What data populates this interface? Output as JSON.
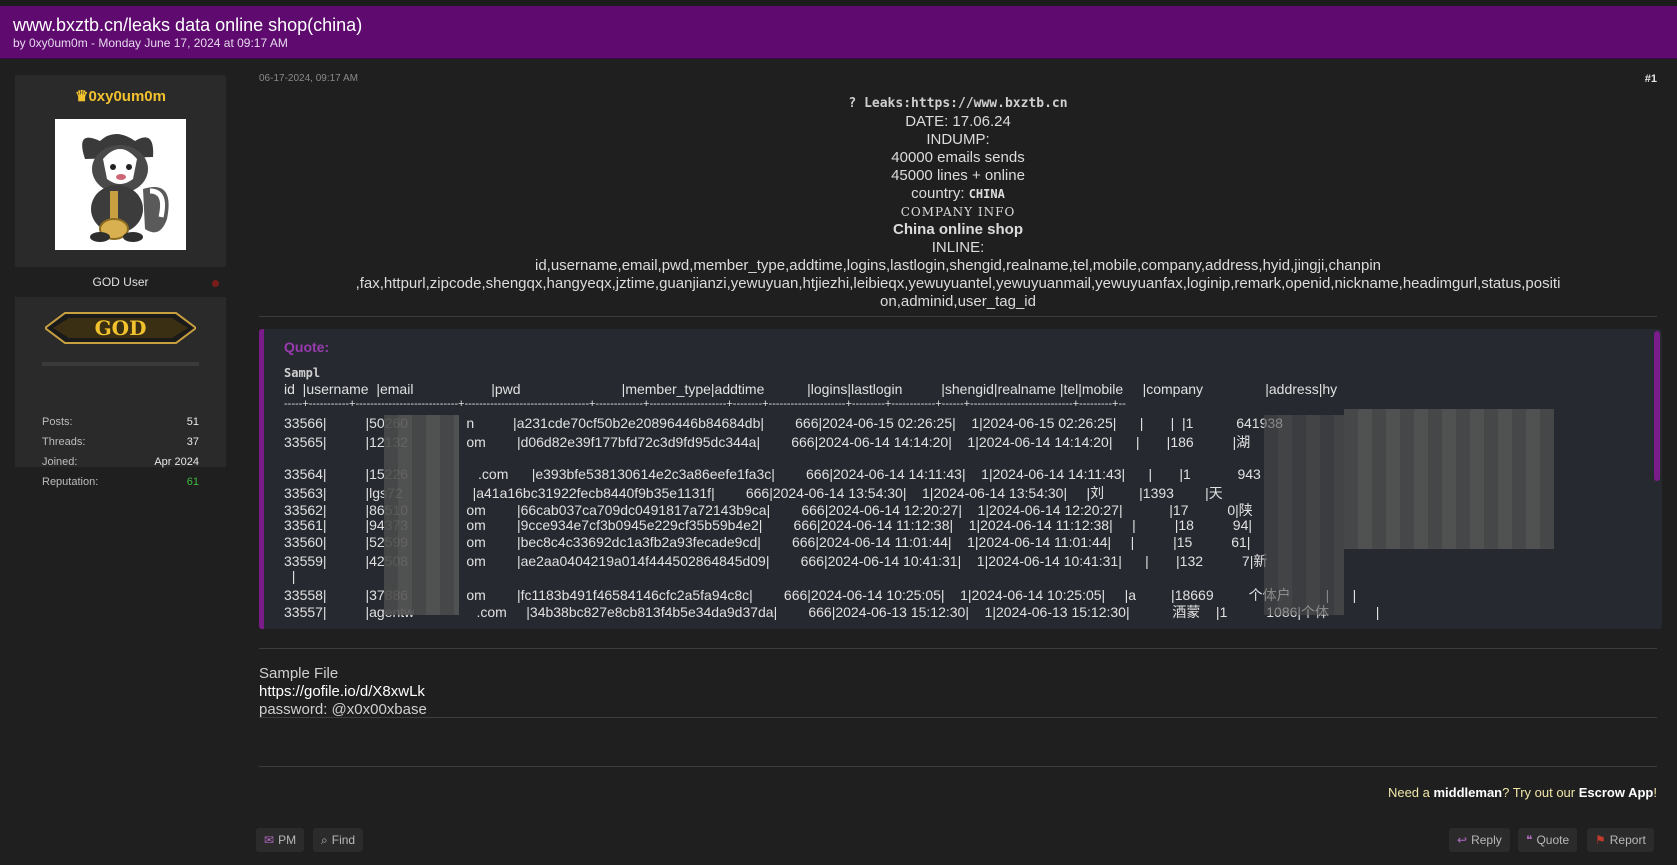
{
  "thread": {
    "title": "www.bxztb.cn/leaks data online shop(china)",
    "byline": "by 0xy0um0m - Monday June 17, 2024 at 09:17 AM"
  },
  "author": {
    "crown": "♛",
    "username": "0xy0um0m",
    "usertitle": "GOD User",
    "badge": "GOD",
    "stats": [
      {
        "label": "Posts:",
        "value": "51"
      },
      {
        "label": "Threads:",
        "value": "37"
      },
      {
        "label": "Joined:",
        "value": "Apr 2024"
      },
      {
        "label": "Reputation:",
        "value": "61"
      }
    ]
  },
  "post": {
    "date": "06-17-2024, 09:17 AM",
    "number": "#1",
    "leaks_line": "? Leaks:https://www.bxztb.cn",
    "date_line": "DATE: 17.06.24",
    "indump": "INDUMP:",
    "emails": "40000 emails sends",
    "lines": "45000 lines + online",
    "country_label": "country: ",
    "country_value": "CHINA",
    "company_info": "COMPANY INFO",
    "company_name": "China online shop",
    "inline": "INLINE:",
    "columns_1": "id,username,email,pwd,member_type,addtime,logins,lastlogin,shengid,realname,tel,mobile,company,address,hyid,jingji,chanpin",
    "columns_2": ",fax,httpurl,zipcode,shengqx,hangyeqx,jztime,guanjianzi,yewuyuan,htjiezhi,leibieqx,yewuyuantel,yewuyuanmail,yewuyuanfax,loginip,remark,openid,nickname,headimgurl,status,positi",
    "columns_3": "on,adminid,user_tag_id"
  },
  "quote": {
    "label": "Quote:",
    "sampl": "Sampl",
    "header": "id  |username  |email                    |pwd                          |member_type|addtime           |logins|lastlogin          |shengid|realname |tel|mobile     |company                |address|hy",
    "divider": "-----+-----------+----------------------------+----------------------------------+-------------+---------------------+--------+---------------------+---------+------------+------+----------------------------+---------+--",
    "rows": [
      "33566|          |50260               n          |a231cde70cf50b2e20896446b84684db|        666|2024-06-15 02:26:25|    1|2024-06-15 02:26:25|      |       |  |1           641938",
      "33565|          |12132               om        |d06d82e39f177bfd72c3d9fd95dc344a|        666|2024-06-14 14:14:20|    1|2024-06-14 14:14:20|      |       |186          |湖",
      "",
      "33564|          |15226                  .com      |e393bfe538130614e2c3a86eefe1fa3c|        666|2024-06-14 14:11:43|    1|2024-06-14 14:11:43|      |       |1            943",
      "33563|          |lgs72                  |a41a16bc31922fecb8440f9b35e1131f|        666|2024-06-14 13:54:30|    1|2024-06-14 13:54:30|     |刘         |1393        |天",
      "33562|          |86510               om        |66cab037ca709dc0491817a72143b9ca|        666|2024-06-14 12:20:27|    1|2024-06-14 12:20:27|            |17          0|陕",
      "33561|          |94373               om        |9cce934e7cf3b0945e229cf35b59b4e2|        666|2024-06-14 11:12:38|    1|2024-06-14 11:12:38|     |          |18          94|",
      "33560|          |52599               om        |bec8c4c33692dc1a3fb2a93fecade9cd|        666|2024-06-14 11:01:44|    1|2024-06-14 11:01:44|     |          |15          61|",
      "33559|          |42508               om        |ae2aa0404219a014f444502864845d09|        666|2024-06-14 10:41:31|    1|2024-06-14 10:41:31|      |       |132          7|新",
      "  |",
      "33558|          |37886               om        |fc1183b491f46584146cfc2a5fa94c8c|        666|2024-06-14 10:25:05|    1|2024-06-14 10:25:05|     |a         |18669         个体户         |      |",
      "33557|          |agentw                .com     |34b38bc827e8cb813f4b5e34da9d37da|        666|2024-06-13 15:12:30|    1|2024-06-13 15:12:30|           酒蒙    |1          1086|个体            |"
    ]
  },
  "sample": {
    "label": "Sample File",
    "link": "https://gofile.io/d/X8xwLk",
    "password": "password: @x0x00xbase"
  },
  "footer": {
    "escrow_prefix": "Need a ",
    "escrow_mid": "middleman",
    "escrow_mid2": "? Try out our ",
    "escrow_app": "Escrow App",
    "escrow_suffix": "!",
    "pm": "PM",
    "find": "Find",
    "reply": "Reply",
    "quote": "Quote",
    "report": "Report"
  },
  "colors": {
    "header_bg": "#5e0a6f",
    "username": "#f2c12e",
    "reputation": "#3db93d",
    "quote_accent": "#7b1c8b"
  }
}
